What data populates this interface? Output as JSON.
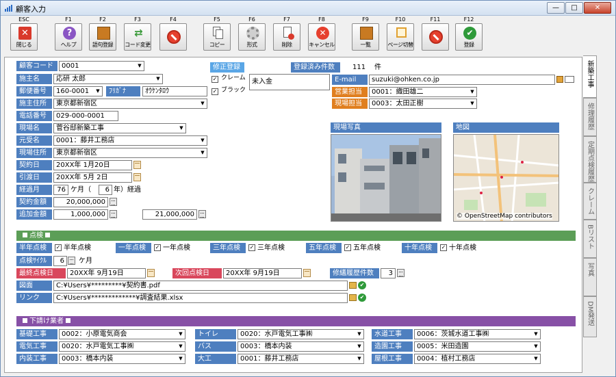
{
  "window": {
    "title": "顧客入力",
    "min": "—",
    "max": "□",
    "close": "✕"
  },
  "toolbar": [
    {
      "key": "ESC",
      "label": "閉じる",
      "icon": "close-x-icon"
    },
    {
      "key": "F1",
      "label": "ヘルプ",
      "icon": "help-icon"
    },
    {
      "key": "F2",
      "label": "語句登録",
      "icon": "book-icon"
    },
    {
      "key": "F3",
      "label": "コード変更",
      "icon": "shuffle-icon"
    },
    {
      "key": "F4",
      "label": "",
      "icon": "no-entry-icon"
    },
    {
      "key": "F5",
      "label": "コピー",
      "icon": "copy-icon"
    },
    {
      "key": "F6",
      "label": "形式",
      "icon": "gear-icon"
    },
    {
      "key": "F7",
      "label": "削除",
      "icon": "delete-doc-icon"
    },
    {
      "key": "F8",
      "label": "キャンセル",
      "icon": "cancel-icon"
    },
    {
      "key": "F9",
      "label": "一覧",
      "icon": "list-book-icon"
    },
    {
      "key": "F10",
      "label": "ページ切替",
      "icon": "page-switch-icon"
    },
    {
      "key": "F11",
      "label": "",
      "icon": "no-entry-icon"
    },
    {
      "key": "F12",
      "label": "登録",
      "icon": "check-icon"
    }
  ],
  "form": {
    "customer_code": {
      "label": "顧客コード",
      "value": "0001"
    },
    "client_name": {
      "label": "施主名",
      "value": "応研 太郎"
    },
    "postal": {
      "label": "郵便番号",
      "value": "160-0001",
      "furigana_label": "ﾌﾘｶﾞﾅ",
      "furigana": "ｵｳｹﾝﾀﾛｳ"
    },
    "client_address": {
      "label": "施主住所",
      "value": "東京都新宿区"
    },
    "phone": {
      "label": "電話番号",
      "value": "029-000-0001"
    },
    "site_name": {
      "label": "現場名",
      "value": "菅谷邸新築工事"
    },
    "contractor": {
      "label": "元受名",
      "value": "0001：藤井工務店"
    },
    "site_address": {
      "label": "現場住所",
      "value": "東京都新宿区"
    },
    "contract_date": {
      "label": "契約日",
      "value": "20XX年 1月20日"
    },
    "delivery_date": {
      "label": "引渡日",
      "value": "20XX年 5月 2日"
    },
    "elapsed": {
      "label": "経過月",
      "months": "76",
      "unit_m": "ケ月（",
      "years": "6",
      "unit_y": "年）経過"
    },
    "contract_amount": {
      "label": "契約金額",
      "value": "20,000,000"
    },
    "additional_amount": {
      "label": "追加金額",
      "value": "1,000,000",
      "total": "21,000,000"
    },
    "correction": {
      "label": "修正登録",
      "claim": "クレーム",
      "black": "ブラック",
      "unpaid": "未入金"
    },
    "registered_count": {
      "label": "登録済み件数",
      "value": "111",
      "unit": "件"
    },
    "email": {
      "label": "E-mail",
      "value": "suzuki@ohken.co.jp"
    },
    "sales_rep": {
      "label": "営業担当",
      "value": "0001：織田雄二"
    },
    "site_rep": {
      "label": "現場担当",
      "value": "0003：太田正樹"
    },
    "site_photo_label": "現場写真",
    "map_label": "地図",
    "map_credit": "© OpenStreetMap contributors"
  },
  "inspection": {
    "title": "点検",
    "items": [
      {
        "label": "半年点検",
        "text": "半年点検"
      },
      {
        "label": "一年点検",
        "text": "一年点検"
      },
      {
        "label": "三年点検",
        "text": "三年点検"
      },
      {
        "label": "五年点検",
        "text": "五年点検"
      },
      {
        "label": "十年点検",
        "text": "十年点検"
      }
    ],
    "cycle_label": "点検ｻｲｸﾙ",
    "cycle": "6",
    "cycle_unit": "ケ月",
    "last_label": "最終点検日",
    "last": "20XX年 9月19日",
    "next_label": "次回点検日",
    "next": "20XX年 9月19日",
    "repair_label": "修繕履歴件数",
    "repair": "3",
    "drawing_label": "図面",
    "drawing": "C:¥Users¥*********¥契約書.pdf",
    "link_label": "リンク",
    "link": "C:¥Users¥*************¥調査結果.xlsx"
  },
  "subcontractors": {
    "title": "下請け業者",
    "rows": [
      [
        {
          "label": "基礎工事",
          "value": "0002：小原電気商会"
        },
        {
          "label": "トイレ",
          "value": "0020：水戸電気工事㈱"
        },
        {
          "label": "水道工事",
          "value": "0006：茨城水道工事㈱"
        }
      ],
      [
        {
          "label": "電気工事",
          "value": "0020：水戸電気工事㈱"
        },
        {
          "label": "バス",
          "value": "0003：橋本内装"
        },
        {
          "label": "造園工事",
          "value": "0005：米田造園"
        }
      ],
      [
        {
          "label": "内装工事",
          "value": "0003：橋本内装"
        },
        {
          "label": "大工",
          "value": "0001：藤井工務店"
        },
        {
          "label": "屋根工事",
          "value": "0004：植村工務店"
        }
      ]
    ]
  },
  "side_tabs": [
    "新築工事",
    "修理履歴",
    "定期点検履歴",
    "クレーム",
    "Bリスト",
    "写真",
    "DM発送"
  ],
  "colors": {
    "label_blue": "#4e7fbf",
    "inspection_bar": "#5c9e57",
    "subcontract_bar": "#8750a6"
  }
}
